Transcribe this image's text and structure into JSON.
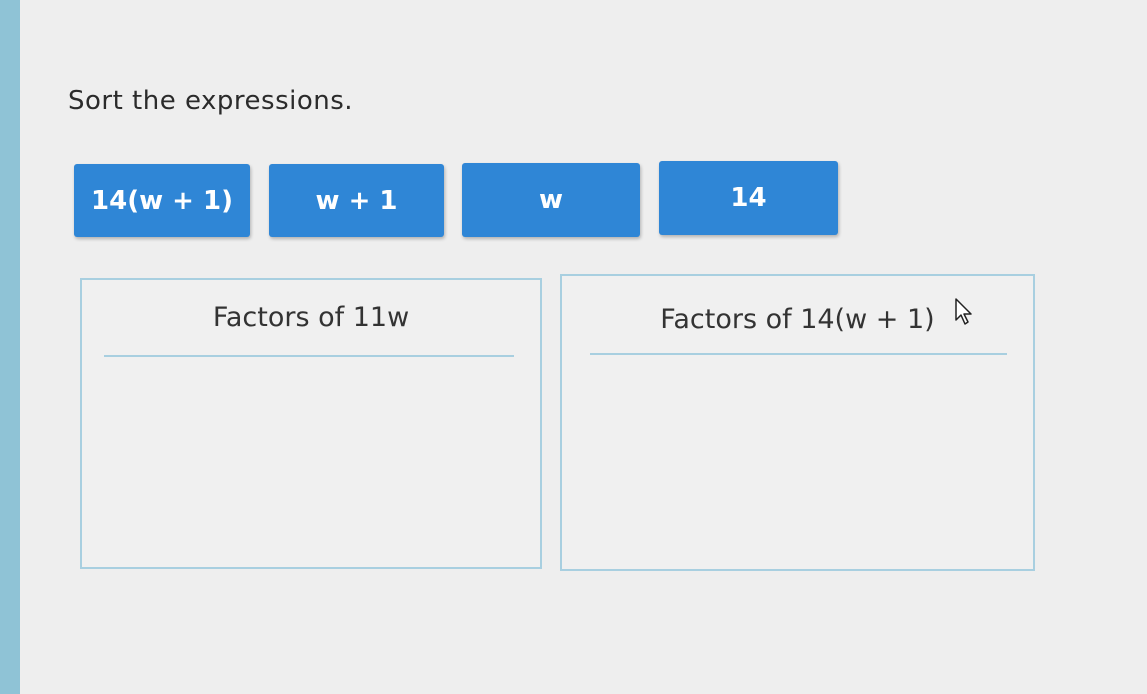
{
  "prompt": "Sort the expressions.",
  "tiles": [
    {
      "label": "14(w + 1)"
    },
    {
      "label": "w + 1"
    },
    {
      "label": "w"
    },
    {
      "label": "14"
    }
  ],
  "zones": [
    {
      "prefix": "Factors of ",
      "expression": "11w"
    },
    {
      "prefix": "Factors of ",
      "expression": "14(w + 1)"
    }
  ],
  "colors": {
    "tile": "#2f86d6",
    "zone_border": "#a8cfe0",
    "background": "#eeeeee",
    "sidebar": "#8fc3d6"
  },
  "icons": {
    "pointer": "arrow-cursor-icon"
  }
}
